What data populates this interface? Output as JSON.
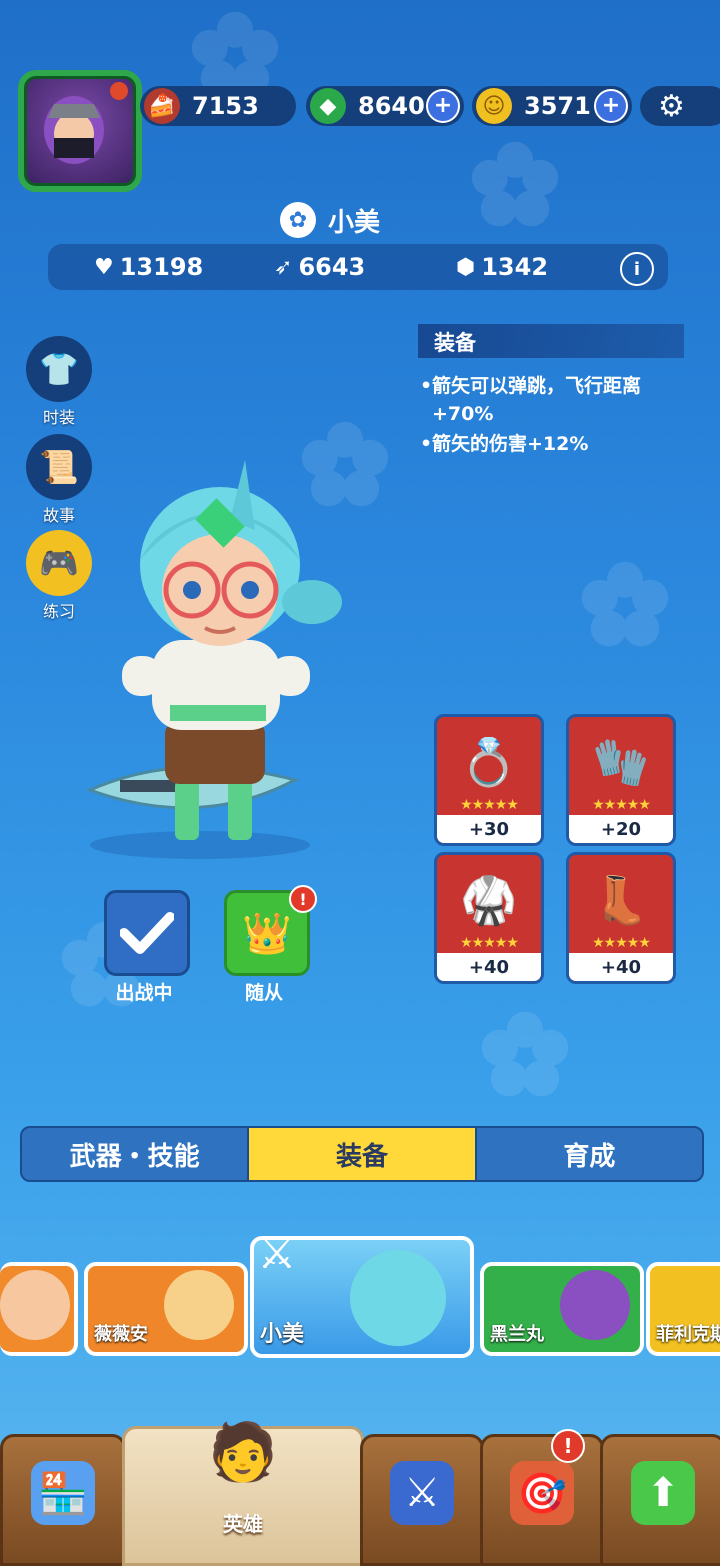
{
  "topbar": {
    "cake": {
      "value": "7153",
      "icon": "cake-icon"
    },
    "gems": {
      "value": "8640",
      "icon": "gem-icon"
    },
    "coins": {
      "value": "3571",
      "icon": "coin-icon"
    },
    "plus": "+",
    "settings_icon": "gear-icon"
  },
  "hero": {
    "name": "小美",
    "stats": {
      "health": "13198",
      "attack": "6643",
      "defense": "1342"
    }
  },
  "side_buttons": {
    "costume": "时装",
    "story": "故事",
    "practice": "练习"
  },
  "equipment_panel": {
    "title": "装备",
    "bullet": "•",
    "desc1": "箭矢可以弹跳，飞行距离+70%",
    "desc2": "箭矢的伤害+12%"
  },
  "equipment_items": [
    {
      "name": "wing-ring",
      "bonus": "+30",
      "stars": 5
    },
    {
      "name": "glove",
      "bonus": "+20",
      "stars": 5
    },
    {
      "name": "armor",
      "bonus": "+40",
      "stars": 5
    },
    {
      "name": "boots",
      "bonus": "+40",
      "stars": 5
    }
  ],
  "actions": {
    "deploy": "出战中",
    "follower": "随从",
    "alert": "!"
  },
  "tabs": [
    "武器・技能",
    "装备",
    "育成"
  ],
  "active_tab": 1,
  "heroes": [
    "",
    "薇薇安",
    "小美",
    "黑兰丸",
    "菲利克斯"
  ],
  "selected_hero": 2,
  "bottom_nav": [
    {
      "label": "",
      "icon": "shop-icon"
    },
    {
      "label": "英雄",
      "icon": "hero-icon"
    },
    {
      "label": "",
      "icon": "battle-icon"
    },
    {
      "label": "",
      "icon": "target-icon"
    },
    {
      "label": "",
      "icon": "upgrade-arrow-icon"
    }
  ],
  "colors": {
    "accent_tab": "#ffd93a",
    "card_bg": "#c8342f",
    "stars": "#ffd23a"
  }
}
